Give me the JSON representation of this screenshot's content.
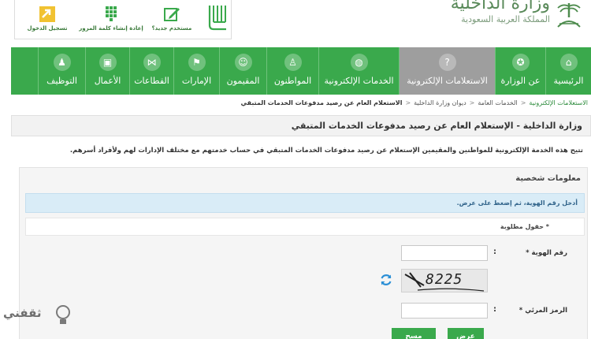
{
  "header": {
    "ministry_title": "وزارة الداخلية",
    "country_name": "المملكة العربية السعودية",
    "quick_links": [
      {
        "label": "مستخدم جديد؟",
        "icon": "edit-icon"
      },
      {
        "label": "إعادة إنشاء كلمة المرور",
        "icon": "password-keypad-icon"
      },
      {
        "label": "تسجيل الدخول",
        "icon": "login-arrow-icon"
      }
    ]
  },
  "nav": {
    "items": [
      {
        "label": "الرئيسية",
        "icon": "home-icon",
        "glyph": "⌂"
      },
      {
        "label": "عن الوزارة",
        "icon": "emblem-icon",
        "glyph": "✪"
      },
      {
        "label": "الاستعلامات الإلكترونية",
        "icon": "inquiry-icon",
        "glyph": "?"
      },
      {
        "label": "الخدمات الإلكترونية",
        "icon": "globe-icon",
        "glyph": "◍"
      },
      {
        "label": "المواطنون",
        "icon": "citizen-icon",
        "glyph": "♙"
      },
      {
        "label": "المقيمون",
        "icon": "residents-icon",
        "glyph": "☺"
      },
      {
        "label": "الإمارات",
        "icon": "flag-icon",
        "glyph": "⚑"
      },
      {
        "label": "القطاعات",
        "icon": "share-icon",
        "glyph": "⋈"
      },
      {
        "label": "الأعمال",
        "icon": "briefcase-icon",
        "glyph": "▣"
      },
      {
        "label": "التوظيف",
        "icon": "group-icon",
        "glyph": "♟"
      }
    ],
    "active_index": 2
  },
  "breadcrumb": {
    "items": [
      "الاستعلامات الإلكترونية",
      "الخدمات العامة",
      "ديوان وزارة الداخلية"
    ],
    "current": "الاستعلام العام عن رصيد مدفوعات الخدمات المتبقي"
  },
  "page": {
    "title": "وزارة الداخلية - الإستعلام العام عن رصيد مدفوعات الخدمات المتبقي",
    "intro": "تتيح هذه الخدمة الإلكترونية للمواطنين والمقيمين الإستعلام عن رصيد مدفوعات الخدمات المتبقي في حساب خدمتهم مع مختلف الإدارات لهم ولأفراد أسرهم."
  },
  "form": {
    "panel_title": "معلومات شخصية",
    "info_message": "أدخل رقم الهوية، ثم إضغط على عرض.",
    "required_note": "* حقول مطلوبة",
    "id_label": "رقم الهوية *",
    "id_value": "",
    "captcha_label": "الرمز المرئي *",
    "captcha_value": "",
    "captcha_text": "8225",
    "colon": ":",
    "submit_label": "عرض",
    "clear_label": "مسح"
  },
  "watermark": {
    "text": "ثقفني"
  },
  "colors": {
    "brand_green": "#3aa94c",
    "active_gray": "#9e9e9e",
    "alert_blue": "#d9ecf7"
  }
}
